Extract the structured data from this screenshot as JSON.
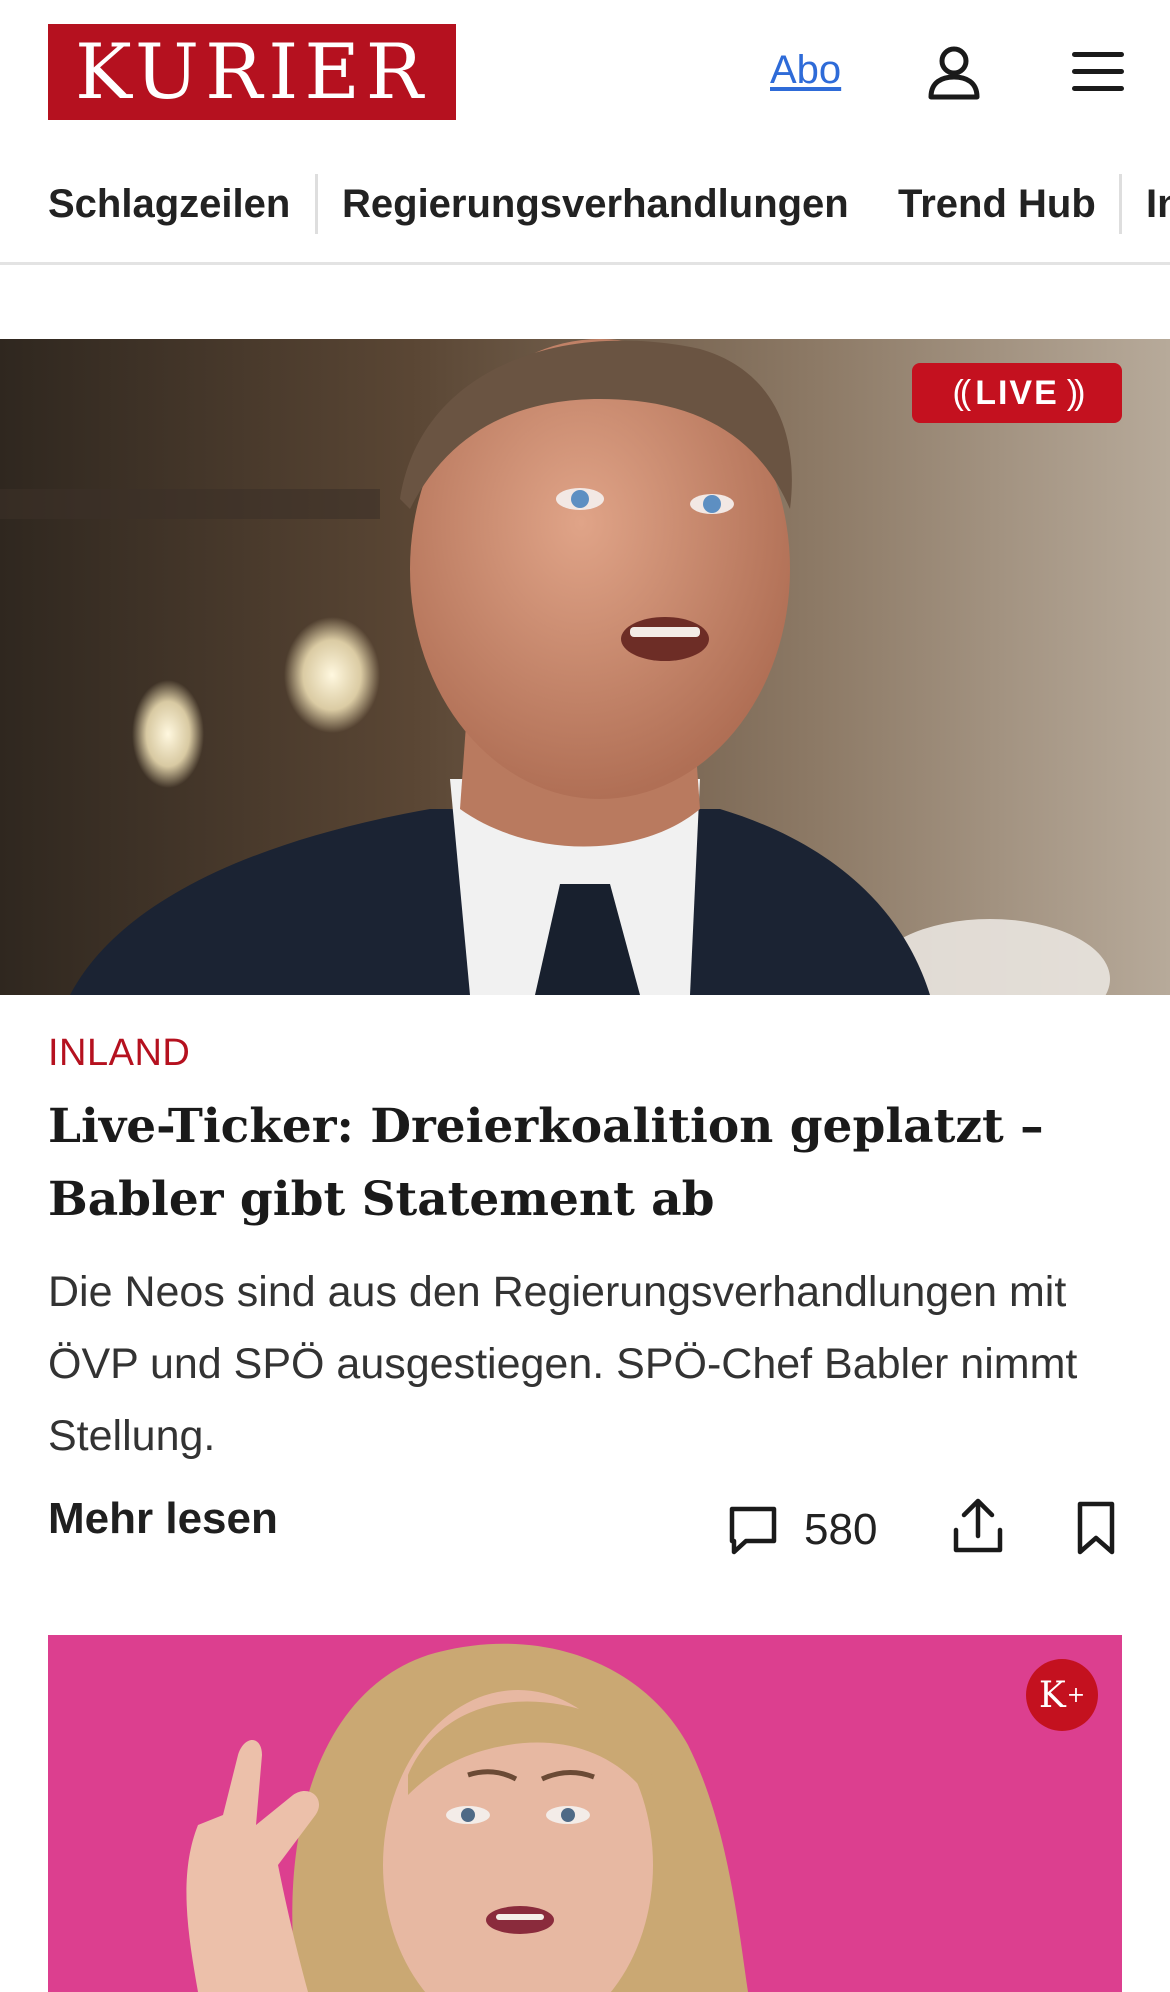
{
  "header": {
    "logo_text": "KURIER",
    "abo_label": "Abo",
    "user_icon": "user-icon",
    "menu_icon": "hamburger-menu-icon",
    "brand_color": "#b5111f"
  },
  "nav": {
    "items": [
      {
        "label": "Schlagzeilen"
      },
      {
        "label": "Regierungsverhandlungen"
      },
      {
        "label": "Trend Hub"
      },
      {
        "label": "In"
      }
    ]
  },
  "articles": [
    {
      "image_icon": "photo",
      "badge": "LIVE",
      "category": "INLAND",
      "headline": "Live-Ticker: Dreierkoalition geplatzt – Babler gibt Statement ab",
      "teaser": "Die Neos sind aus den Regierungsverhandlungen mit ÖVP und SPÖ ausgestiegen. SPÖ-Chef Babler nimmt Stellung.",
      "read_more": "Mehr lesen",
      "comments_count": "580",
      "comment_icon": "comment-icon",
      "share_icon": "share-icon",
      "bookmark_icon": "bookmark-icon"
    },
    {
      "image_icon": "photo",
      "premium_badge": "K",
      "premium_badge_sup": "+"
    }
  ]
}
